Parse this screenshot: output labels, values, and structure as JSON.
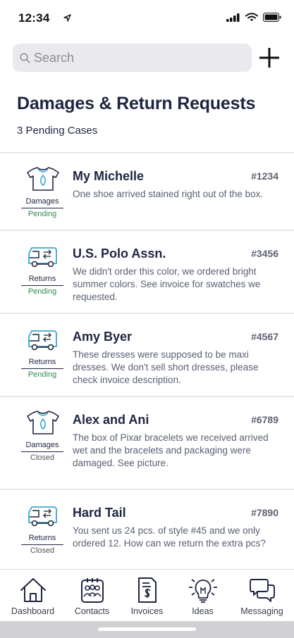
{
  "status_bar": {
    "time": "12:34"
  },
  "search": {
    "placeholder": "Search"
  },
  "header": {
    "title": "Damages & Return Requests",
    "subtitle": "3 Pending Cases"
  },
  "cases": [
    {
      "type": "Damages",
      "icon": "shirt-icon",
      "status": "Pending",
      "name": "My Michelle",
      "number": "#1234",
      "description": "One shoe arrived stained right out of the box."
    },
    {
      "type": "Returns",
      "icon": "truck-icon",
      "status": "Pending",
      "name": "U.S. Polo Assn.",
      "number": "#3456",
      "description": "We didn't order this color, we ordered bright summer colors.  See invoice for swatches we requested."
    },
    {
      "type": "Returns",
      "icon": "truck-icon",
      "status": "Pending",
      "name": "Amy Byer",
      "number": "#4567",
      "description": "These dresses were supposed to be maxi dresses.  We don't sell short dresses, please check invoice description."
    },
    {
      "type": "Damages",
      "icon": "shirt-icon",
      "status": "Closed",
      "name": "Alex and Ani",
      "number": "#6789",
      "description": "The box of Pixar bracelets we received arrived wet and the bracelets and packaging were damaged.  See picture."
    },
    {
      "type": "Returns",
      "icon": "truck-icon",
      "status": "Closed",
      "name": "Hard Tail",
      "number": "#7890",
      "description": "You sent us 24 pcs. of style #45 and we only ordered 12.  How can we return the extra pcs?"
    }
  ],
  "tabs": [
    {
      "label": "Dashboard",
      "icon": "home-icon"
    },
    {
      "label": "Contacts",
      "icon": "contacts-icon"
    },
    {
      "label": "Invoices",
      "icon": "invoice-icon"
    },
    {
      "label": "Ideas",
      "icon": "lightbulb-icon"
    },
    {
      "label": "Messaging",
      "icon": "messaging-icon"
    }
  ],
  "colors": {
    "title": "#1f2540",
    "pending": "#2e8b4a",
    "icon_accent": "#3aa7d6",
    "search_bg": "#e9e9ee"
  }
}
